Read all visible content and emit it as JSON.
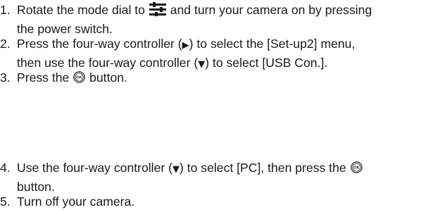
{
  "steps": [
    {
      "number": "1.",
      "line1_a": "Rotate the mode dial to",
      "line1_icon": "setup-mode-icon",
      "line1_b": "and turn your camera on by pressing",
      "line2": "the power switch."
    },
    {
      "number": "2.",
      "line1_a": "Press the four-way controller (",
      "line1_arrow": "▶",
      "line1_b": ") to select the [Set-up2] menu,",
      "line2_a": "then use the four-way controller (",
      "line2_arrow": "▼",
      "line2_b": ") to select [USB Con.]."
    },
    {
      "number": "3.",
      "line1_a": "Press the",
      "line1_icon": "ok-button-icon",
      "line1_b": "button."
    },
    {
      "number": "4.",
      "line1_a": "Use the four-way controller (",
      "line1_arrow": "▼",
      "line1_b": ") to select [PC], then press the",
      "line1_icon": "ok-button-icon",
      "line2": "button."
    },
    {
      "number": "5.",
      "line1": "Turn off your camera."
    }
  ]
}
